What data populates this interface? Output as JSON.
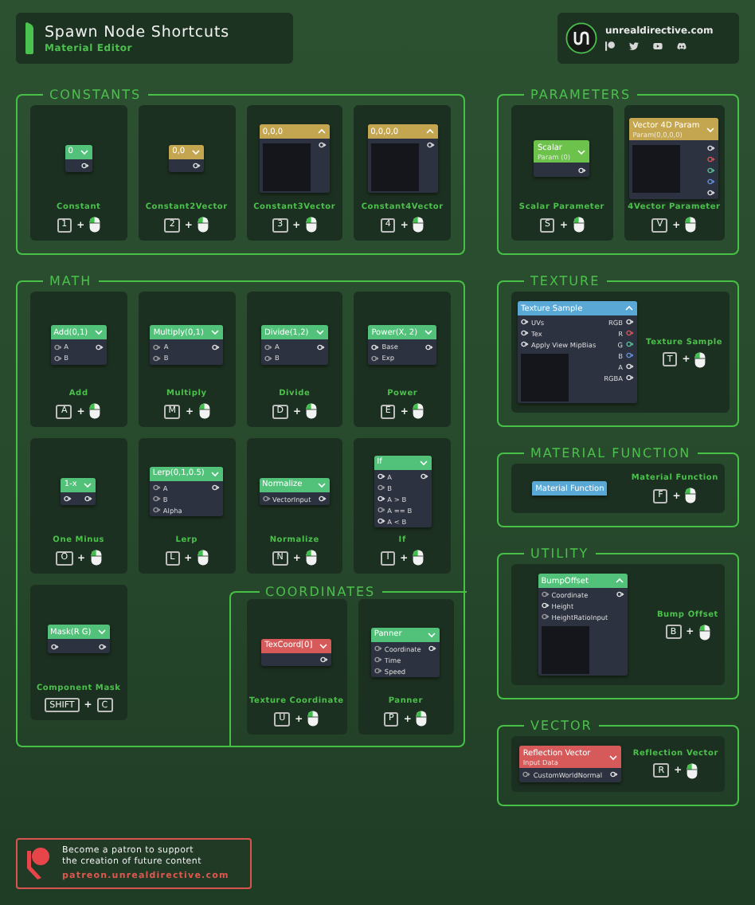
{
  "header": {
    "title": "Spawn Node Shortcuts",
    "subtitle": "Material Editor"
  },
  "social": {
    "site": "unrealdirective.com"
  },
  "left_sections": [
    {
      "title": "CONSTANTS",
      "cards": [
        {
          "kind": "tall",
          "label": "Constant",
          "shortcut": [
            {
              "kind": "key",
              "text": "1"
            },
            {
              "kind": "plus",
              "text": "+"
            },
            {
              "kind": "mouse"
            }
          ],
          "node": {
            "title": "0",
            "color": "#52c27a",
            "expanded": false,
            "outputs": [
              {
                "color": "#e0e0e0"
              }
            ]
          }
        },
        {
          "kind": "tall",
          "label": "Constant2Vector",
          "shortcut": [
            {
              "kind": "key",
              "text": "2"
            },
            {
              "kind": "plus",
              "text": "+"
            },
            {
              "kind": "mouse"
            }
          ],
          "node": {
            "title": "0,0",
            "color": "#c4a650",
            "expanded": false,
            "outputs": [
              {
                "color": "#e0e0e0"
              }
            ]
          }
        },
        {
          "kind": "tall",
          "label": "Constant3Vector",
          "shortcut": [
            {
              "kind": "key",
              "text": "3"
            },
            {
              "kind": "plus",
              "text": "+"
            },
            {
              "kind": "mouse"
            }
          ],
          "node": {
            "title": "0,0,0",
            "color": "#c4a650",
            "expanded": true,
            "preview": true,
            "outputs": [
              {
                "color": "#e0e0e0"
              }
            ]
          }
        },
        {
          "kind": "tall",
          "label": "Constant4Vector",
          "shortcut": [
            {
              "kind": "key",
              "text": "4"
            },
            {
              "kind": "plus",
              "text": "+"
            },
            {
              "kind": "mouse"
            }
          ],
          "node": {
            "title": "0,0,0,0",
            "color": "#c4a650",
            "expanded": true,
            "preview": true,
            "outputs": [
              {
                "color": "#e0e0e0"
              }
            ]
          }
        }
      ]
    },
    {
      "title": "MATH",
      "cards": [
        {
          "kind": "tall",
          "label": "Add",
          "shortcut": [
            {
              "kind": "key",
              "text": "A"
            },
            {
              "kind": "plus",
              "text": "+"
            },
            {
              "kind": "mouse"
            }
          ],
          "node": {
            "title": "Add(0,1)",
            "color": "#52c27a",
            "expanded": false,
            "inputs": [
              {
                "label": "A",
                "color": "#9a9a9a"
              },
              {
                "label": "B",
                "color": "#9a9a9a"
              }
            ],
            "outputs": [
              {
                "color": "#e0e0e0"
              }
            ]
          }
        },
        {
          "kind": "tall",
          "label": "Multiply",
          "shortcut": [
            {
              "kind": "key",
              "text": "M"
            },
            {
              "kind": "plus",
              "text": "+"
            },
            {
              "kind": "mouse"
            }
          ],
          "node": {
            "title": "Multiply(0,1)",
            "color": "#52c27a",
            "expanded": false,
            "inputs": [
              {
                "label": "A",
                "color": "#9a9a9a"
              },
              {
                "label": "B",
                "color": "#9a9a9a"
              }
            ],
            "outputs": [
              {
                "color": "#e0e0e0"
              }
            ]
          }
        },
        {
          "kind": "tall",
          "label": "Divide",
          "shortcut": [
            {
              "kind": "key",
              "text": "D"
            },
            {
              "kind": "plus",
              "text": "+"
            },
            {
              "kind": "mouse"
            }
          ],
          "node": {
            "title": "Divide(1,2)",
            "color": "#52c27a",
            "expanded": false,
            "inputs": [
              {
                "label": "A",
                "color": "#9a9a9a"
              },
              {
                "label": "B",
                "color": "#9a9a9a"
              }
            ],
            "outputs": [
              {
                "color": "#e0e0e0"
              }
            ]
          }
        },
        {
          "kind": "tall",
          "label": "Power",
          "shortcut": [
            {
              "kind": "key",
              "text": "E"
            },
            {
              "kind": "plus",
              "text": "+"
            },
            {
              "kind": "mouse"
            }
          ],
          "node": {
            "title": "Power(X, 2)",
            "color": "#52c27a",
            "expanded": false,
            "inputs": [
              {
                "label": "Base",
                "color": "#e0e0e0"
              },
              {
                "label": "Exp",
                "color": "#9a9a9a"
              }
            ],
            "outputs": [
              {
                "color": "#e0e0e0"
              }
            ]
          }
        },
        {
          "kind": "tall",
          "label": "One Minus",
          "shortcut": [
            {
              "kind": "key",
              "text": "O"
            },
            {
              "kind": "plus",
              "text": "+"
            },
            {
              "kind": "mouse"
            }
          ],
          "node": {
            "title": "1-x",
            "color": "#52c27a",
            "expanded": false,
            "inputs": [
              {
                "color": "#e0e0e0"
              }
            ],
            "outputs": [
              {
                "color": "#e0e0e0"
              }
            ]
          }
        },
        {
          "kind": "tall",
          "label": "Lerp",
          "shortcut": [
            {
              "kind": "key",
              "text": "L"
            },
            {
              "kind": "plus",
              "text": "+"
            },
            {
              "kind": "mouse"
            }
          ],
          "node": {
            "title": "Lerp(0,1,0.5)",
            "color": "#52c27a",
            "expanded": false,
            "inputs": [
              {
                "label": "A",
                "color": "#9a9a9a"
              },
              {
                "label": "B",
                "color": "#9a9a9a"
              },
              {
                "label": "Alpha",
                "color": "#9a9a9a"
              }
            ],
            "outputs": [
              {
                "color": "#e0e0e0"
              }
            ]
          }
        },
        {
          "kind": "tall",
          "label": "Normalize",
          "shortcut": [
            {
              "kind": "key",
              "text": "N"
            },
            {
              "kind": "plus",
              "text": "+"
            },
            {
              "kind": "mouse"
            }
          ],
          "node": {
            "title": "Normalize",
            "color": "#52c27a",
            "expanded": false,
            "inputs": [
              {
                "label": "VectorInput",
                "color": "#9a9a9a"
              }
            ],
            "outputs": [
              {
                "color": "#e0e0e0"
              }
            ]
          }
        },
        {
          "kind": "tall",
          "label": "If",
          "shortcut": [
            {
              "kind": "key",
              "text": "I"
            },
            {
              "kind": "plus",
              "text": "+"
            },
            {
              "kind": "mouse"
            }
          ],
          "node": {
            "title": "If",
            "color": "#52c27a",
            "expanded": false,
            "inputs": [
              {
                "label": "A",
                "color": "#e0e0e0"
              },
              {
                "label": "B",
                "color": "#9a9a9a"
              },
              {
                "label": "A > B",
                "color": "#e0e0e0"
              },
              {
                "label": "A == B",
                "color": "#9a9a9a"
              },
              {
                "label": "A < B",
                "color": "#e0e0e0"
              }
            ],
            "outputs": [
              {
                "color": "#e0e0e0"
              }
            ]
          }
        },
        {
          "kind": "tall",
          "label": "Component Mask",
          "shortcut": [
            {
              "kind": "key",
              "text": "SHIFT"
            },
            {
              "kind": "plus",
              "text": "+"
            },
            {
              "kind": "key",
              "text": "C"
            }
          ],
          "node": {
            "title": "Mask(R G)",
            "color": "#52c27a",
            "expanded": false,
            "inputs": [
              {
                "color": "#e0e0e0"
              }
            ],
            "outputs": [
              {
                "color": "#e0e0e0"
              }
            ]
          }
        }
      ],
      "subsection": {
        "title": "COORDINATES",
        "cards": [
          {
            "kind": "tall",
            "label": "Texture Coordinate",
            "shortcut": [
              {
                "kind": "key",
                "text": "U"
              },
              {
                "kind": "plus",
                "text": "+"
              },
              {
                "kind": "mouse"
              }
            ],
            "node": {
              "title": "TexCoord[0]",
              "color": "#d65a5a",
              "expanded": false,
              "outputs": [
                {
                  "color": "#e0e0e0"
                }
              ]
            }
          },
          {
            "kind": "tall",
            "label": "Panner",
            "shortcut": [
              {
                "kind": "key",
                "text": "P"
              },
              {
                "kind": "plus",
                "text": "+"
              },
              {
                "kind": "mouse"
              }
            ],
            "node": {
              "title": "Panner",
              "color": "#52c27a",
              "expanded": false,
              "inputs": [
                {
                  "label": "Coordinate",
                  "color": "#9a9a9a"
                },
                {
                  "label": "Time",
                  "color": "#9a9a9a"
                },
                {
                  "label": "Speed",
                  "color": "#9a9a9a"
                }
              ],
              "outputs": [
                {
                  "color": "#e0e0e0"
                }
              ]
            }
          }
        ]
      }
    }
  ],
  "right_sections": [
    {
      "title": "PARAMETERS",
      "cards": [
        {
          "kind": "tall",
          "label": "Scalar Parameter",
          "shortcut": [
            {
              "kind": "key",
              "text": "S"
            },
            {
              "kind": "plus",
              "text": "+"
            },
            {
              "kind": "mouse"
            }
          ],
          "node": {
            "title": "Scalar",
            "subtitle": "Param (0)",
            "color": "#6cc24a",
            "expanded": false,
            "outputs": [
              {
                "color": "#e0e0e0"
              }
            ]
          }
        },
        {
          "kind": "tall",
          "label": "4Vector Parameter",
          "shortcut": [
            {
              "kind": "key",
              "text": "V"
            },
            {
              "kind": "plus",
              "text": "+"
            },
            {
              "kind": "mouse"
            }
          ],
          "node": {
            "title": "Vector 4D Param",
            "subtitle": "Param(0,0,0,0)",
            "color": "#c4a650",
            "expanded": false,
            "preview": true,
            "outputs": [
              {
                "color": "#e0e0e0"
              },
              {
                "color": "#d9534f"
              },
              {
                "color": "#4fbf8f"
              },
              {
                "color": "#5b8fd9"
              },
              {
                "color": "#e0e0e0"
              }
            ]
          }
        }
      ]
    },
    {
      "title": "TEXTURE",
      "cards": [
        {
          "kind": "wide",
          "label": "Texture Sample",
          "shortcut": [
            {
              "kind": "key",
              "text": "T"
            },
            {
              "kind": "plus",
              "text": "+"
            },
            {
              "kind": "mouse"
            }
          ],
          "node": {
            "title": "Texture Sample",
            "color": "#5aa8d6",
            "expanded": true,
            "preview": true,
            "inputs": [
              {
                "label": "UVs",
                "color": "#e0e0e0"
              },
              {
                "label": "Tex",
                "color": "#e0e0e0"
              },
              {
                "label": "Apply View MipBias",
                "color": "#e0e0e0"
              }
            ],
            "outputs": [
              {
                "label": "RGB",
                "color": "#e0e0e0"
              },
              {
                "label": "R",
                "color": "#d9534f"
              },
              {
                "label": "G",
                "color": "#4fbf8f"
              },
              {
                "label": "B",
                "color": "#5b8fd9"
              },
              {
                "label": "A",
                "color": "#e0e0e0"
              },
              {
                "label": "RGBA",
                "color": "#e0e0e0"
              }
            ]
          }
        }
      ]
    },
    {
      "title": "MATERIAL FUNCTION",
      "cards": [
        {
          "kind": "wide",
          "label": "Material Function",
          "shortcut": [
            {
              "kind": "key",
              "text": "F"
            },
            {
              "kind": "plus",
              "text": "+"
            },
            {
              "kind": "mouse"
            }
          ],
          "node": {
            "title": "Material Function",
            "color": "#5aa8d6"
          }
        }
      ]
    },
    {
      "title": "UTILITY",
      "cards": [
        {
          "kind": "wide",
          "label": "Bump Offset",
          "shortcut": [
            {
              "kind": "key",
              "text": "B"
            },
            {
              "kind": "plus",
              "text": "+"
            },
            {
              "kind": "mouse"
            }
          ],
          "node": {
            "title": "BumpOffset",
            "color": "#52c27a",
            "expanded": true,
            "preview": true,
            "inputs": [
              {
                "label": "Coordinate",
                "color": "#9a9a9a"
              },
              {
                "label": "Height",
                "color": "#e0e0e0"
              },
              {
                "label": "HeightRatioInput",
                "color": "#9a9a9a"
              }
            ],
            "outputs": [
              {
                "color": "#e0e0e0"
              }
            ]
          }
        }
      ]
    },
    {
      "title": "VECTOR",
      "cards": [
        {
          "kind": "wide",
          "label": "Reflection Vector",
          "shortcut": [
            {
              "kind": "key",
              "text": "R"
            },
            {
              "kind": "plus",
              "text": "+"
            },
            {
              "kind": "mouse"
            }
          ],
          "node": {
            "title": "Reflection Vector",
            "subtitle": "Input Data",
            "color": "#d65a5a",
            "expanded": false,
            "inputs": [
              {
                "label": "CustomWorldNormal",
                "color": "#9a9a9a"
              }
            ],
            "outputs": [
              {
                "color": "#e0e0e0"
              }
            ]
          }
        }
      ]
    }
  ],
  "patreon": {
    "text": "Become a patron to support\nthe creation of future content",
    "link": "patreon.unrealdirective.com"
  }
}
